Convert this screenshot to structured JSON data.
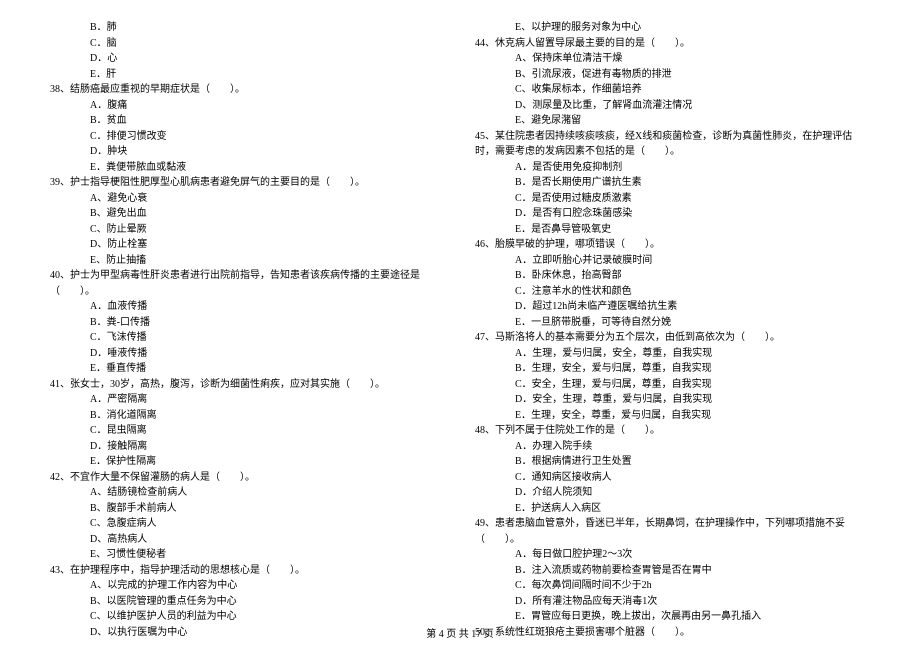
{
  "left": {
    "opts_37": [
      "B．肺",
      "C．脑",
      "D．心",
      "E．肝"
    ],
    "q38": "38、结肠癌最应重视的早期症状是（　　）。",
    "opts_38": [
      "A．腹痛",
      "B．贫血",
      "C．排便习惯改变",
      "D．肿块",
      "E．粪便带脓血或黏液"
    ],
    "q39": "39、护士指导梗阻性肥厚型心肌病患者避免屏气的主要目的是（　　）。",
    "opts_39": [
      "A、避免心衰",
      "B、避免出血",
      "C、防止晕厥",
      "D、防止栓塞",
      "E、防止抽搐"
    ],
    "q40": "40、护士为甲型病毒性肝炎患者进行出院前指导，告知患者该疾病传播的主要途径是（　　）。",
    "opts_40": [
      "A．血液传播",
      "B．粪-口传播",
      "C．飞沫传播",
      "D．唾液传播",
      "E．垂直传播"
    ],
    "q41": "41、张女士，30岁，高热，腹泻，诊断为细菌性痢疾，应对其实施（　　）。",
    "opts_41": [
      "A．严密隔离",
      "B．消化道隔离",
      "C．昆虫隔离",
      "D．接触隔离",
      "E．保护性隔离"
    ],
    "q42": "42、不宜作大量不保留灌肠的病人是（　　）。",
    "opts_42": [
      "A、结肠镜检查前病人",
      "B、腹部手术前病人",
      "C、急腹症病人",
      "D、高热病人",
      "E、习惯性便秘者"
    ],
    "q43": "43、在护理程序中，指导护理活动的思想核心是（　　）。",
    "opts_43": [
      "A、以完成的护理工作内容为中心",
      "B、以医院管理的重点任务为中心",
      "C、以维护医护人员的利益为中心",
      "D、以执行医嘱为中心"
    ]
  },
  "right": {
    "opt_43_e": "E、以护理的服务对象为中心",
    "q44": "44、休克病人留置导尿最主要的目的是（　　）。",
    "opts_44": [
      "A、保持床单位清洁干燥",
      "B、引流尿液，促进有毒物质的排泄",
      "C、收集尿标本，作细菌培养",
      "D、测尿量及比重，了解肾血流灌注情况",
      "E、避免尿潴留"
    ],
    "q45": "45、某住院患者因持续咳痰咳痰，经X线和痰菌检查，诊断为真菌性肺炎，在护理评估时，需要考虑的发病因素不包括的是（　　）。",
    "opts_45": [
      "A．是否使用免疫抑制剂",
      "B．是否长期使用广谱抗生素",
      "C．是否使用过糖皮质激素",
      "D．是否有口腔念珠菌感染",
      "E．是否鼻导管吸氧史"
    ],
    "q46": "46、胎膜早破的护理，哪项错误（　　）。",
    "opts_46": [
      "A．立即听胎心并记录破膜时间",
      "B．卧床休息，抬高臀部",
      "C．注意羊水的性状和颜色",
      "D．超过12h尚未临产遵医嘱给抗生素",
      "E．一旦脐带脱垂，可等待自然分娩"
    ],
    "q47": "47、马斯洛将人的基本需要分为五个层次，由低到高依次为（　　）。",
    "opts_47": [
      "A．生理，爱与归属，安全，尊重，自我实现",
      "B．生理，安全，爱与归属，尊重，自我实现",
      "C．安全，生理，爱与归属，尊重，自我实现",
      "D．安全，生理，尊重，爱与归属，自我实现",
      "E．生理，安全，尊重，爱与归属，自我实现"
    ],
    "q48": "48、下列不属于住院处工作的是（　　）。",
    "opts_48": [
      "A．办理入院手续",
      "B．根据病情进行卫生处置",
      "C．通知病区接收病人",
      "D．介绍人院须知",
      "E．护送病人入病区"
    ],
    "q49": "49、患者患脑血管意外，昏迷已半年，长期鼻饲，在护理操作中，下列哪项措施不妥（　　）。",
    "opts_49": [
      "A．每日做口腔护理2～3次",
      "B．注入流质或药物前要检查胃管是否在胃中",
      "C．每次鼻饲间隔时间不少于2h",
      "D．所有灌注物品应每天消毒1次",
      "E．胃管应每日更换，晚上拔出，次晨再由另一鼻孔插入"
    ],
    "q50": "50、系统性红斑狼疮主要损害哪个脏器（　　）。"
  },
  "footer": "第 4 页 共 17 页"
}
